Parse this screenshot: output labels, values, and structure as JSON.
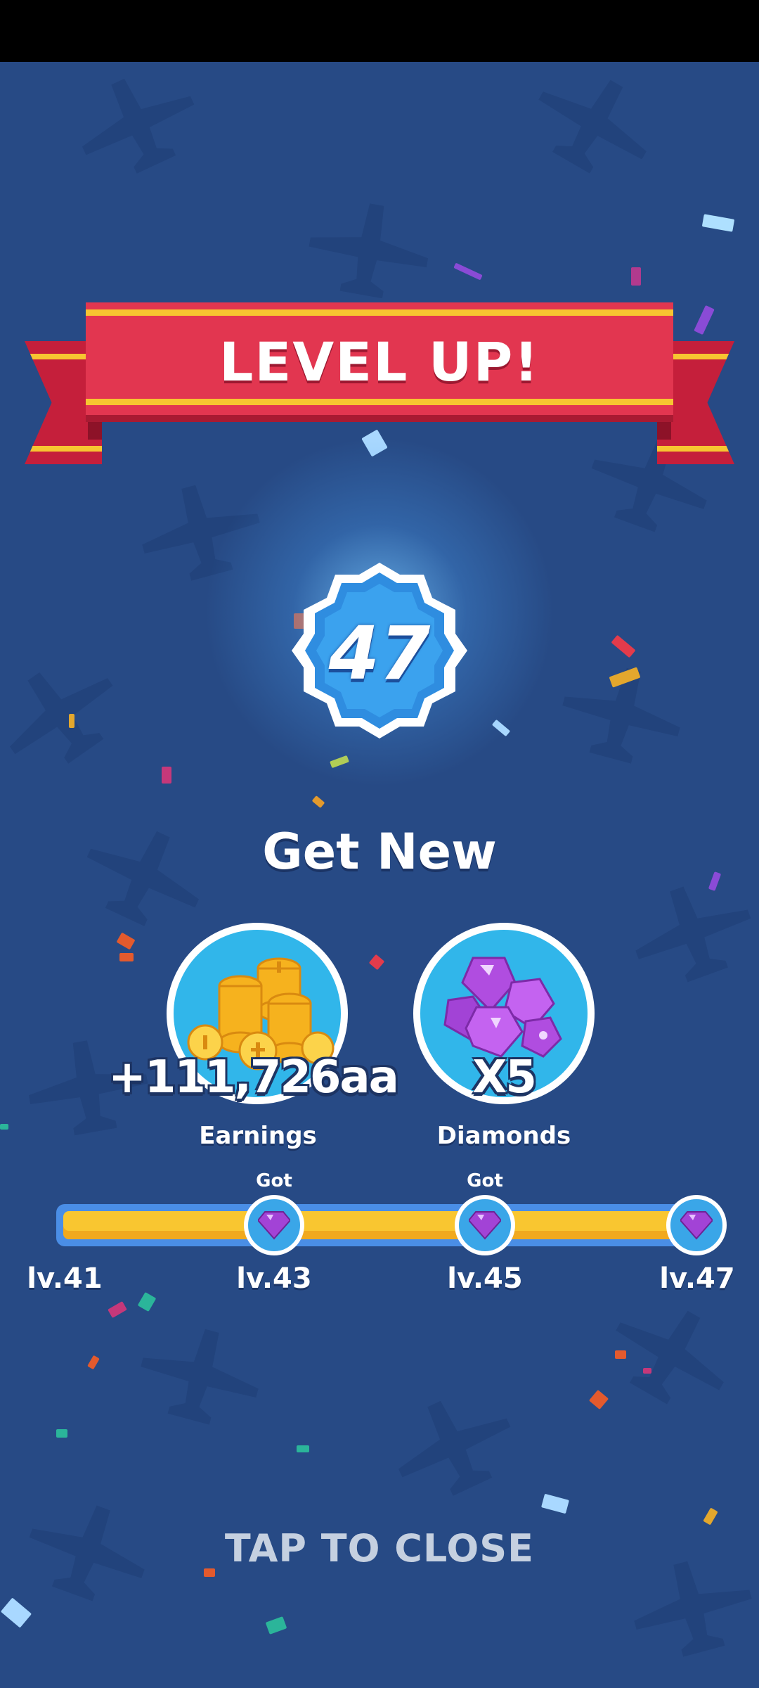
{
  "banner": {
    "title": "LEVEL UP!"
  },
  "level": {
    "value": "47"
  },
  "section": {
    "title": "Get New"
  },
  "rewards": [
    {
      "value": "+111,726aa",
      "label": "Earnings",
      "icon": "gold-coins-icon"
    },
    {
      "value": "X5",
      "label": "Diamonds",
      "icon": "diamonds-icon"
    }
  ],
  "progress": {
    "fill_fraction": 0.96,
    "milestones": [
      {
        "level": "lv.41",
        "status": ""
      },
      {
        "level": "lv.43",
        "status": "Got"
      },
      {
        "level": "lv.45",
        "status": "Got"
      },
      {
        "level": "lv.47",
        "status": ""
      }
    ]
  },
  "close": {
    "label": "TAP TO CLOSE"
  },
  "colors": {
    "background": "#274a85",
    "ribbon": "#e23650",
    "ribbon_stripe": "#f7c531",
    "badge": "#2f8de0",
    "reward_circle": "#31b6ea",
    "progress_fill": "#f9c630",
    "progress_track": "#4a8ee6",
    "diamond": "#b04de0"
  }
}
